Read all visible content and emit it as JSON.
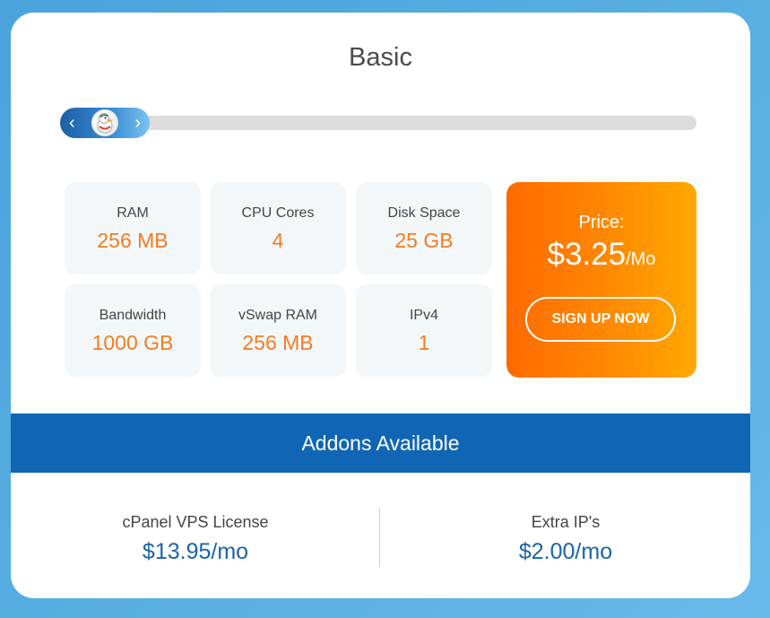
{
  "plan": {
    "title": "Basic"
  },
  "slider": {
    "prev_icon": "‹",
    "next_icon": "›",
    "mascot": "duck-mascot"
  },
  "specs": [
    {
      "label": "RAM",
      "value": "256 MB"
    },
    {
      "label": "CPU Cores",
      "value": "4"
    },
    {
      "label": "Disk Space",
      "value": "25 GB"
    },
    {
      "label": "Bandwidth",
      "value": "1000 GB"
    },
    {
      "label": "vSwap RAM",
      "value": "256 MB"
    },
    {
      "label": "IPv4",
      "value": "1"
    }
  ],
  "price": {
    "label": "Price:",
    "amount": "$3.25",
    "period": "/Mo",
    "signup_label": "SIGN UP NOW"
  },
  "addons": {
    "title": "Addons Available",
    "items": [
      {
        "name": "cPanel VPS License",
        "price": "$13.95/mo"
      },
      {
        "name": "Extra IP's",
        "price": "$2.00/mo"
      }
    ]
  },
  "colors": {
    "accent_orange": "#f47b20",
    "brand_blue": "#1066b5"
  }
}
